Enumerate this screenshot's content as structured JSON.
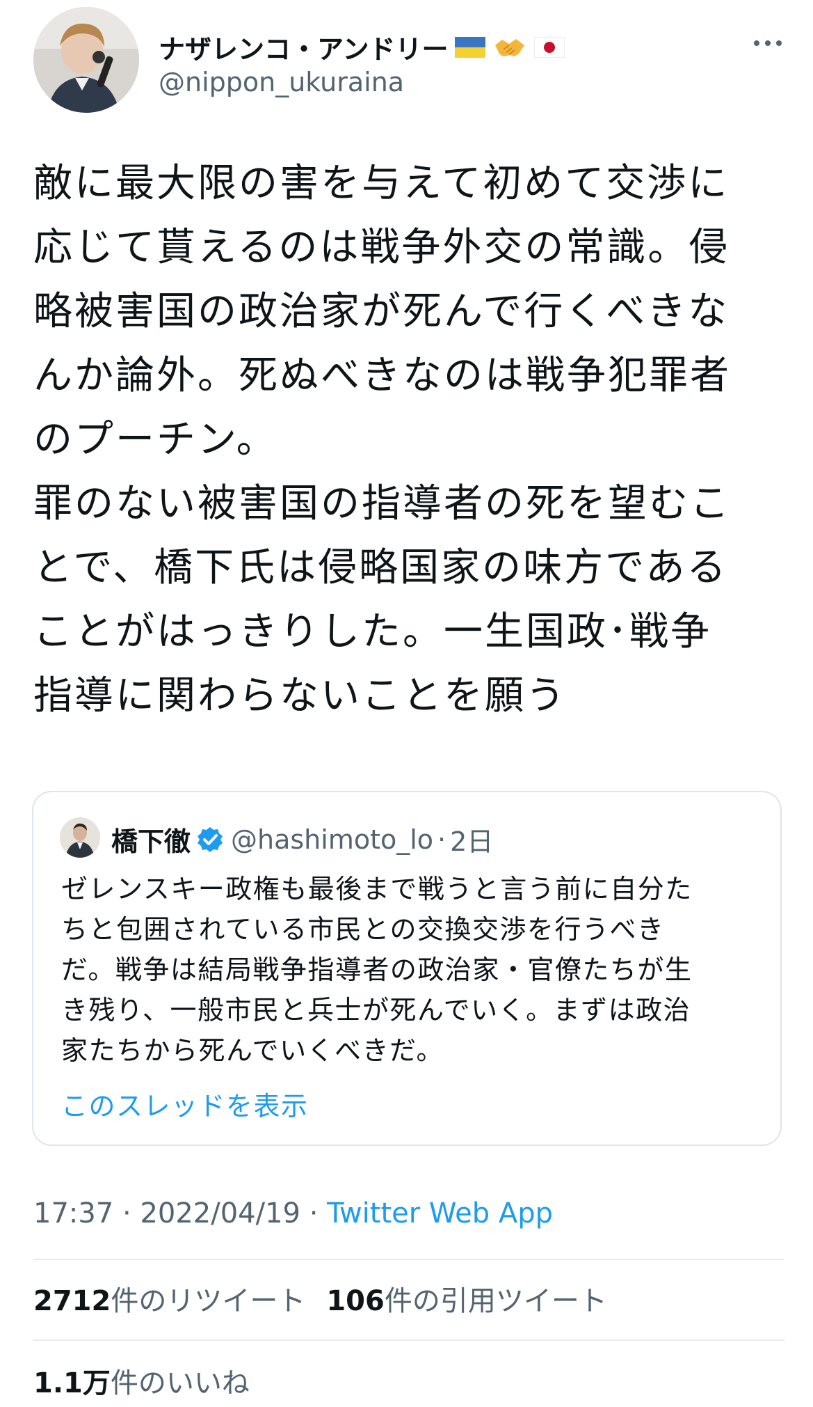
{
  "author": {
    "display_name": "ナザレンコ・アンドリー",
    "handle": "@nippon_ukuraina",
    "flags": [
      "ukraine-flag-icon",
      "handshake-icon",
      "japan-flag-icon"
    ]
  },
  "tweet": {
    "lines": [
      "敵に最大限の害を与えて初めて交渉に",
      "応じて貰えるのは戦争外交の常識。侵",
      "略被害国の政治家が死んで行くべきな",
      "んか論外。死ぬべきなのは戦争犯罪者",
      "のプーチン。",
      "罪のない被害国の指導者の死を望むこ",
      "とで、橋下氏は侵略国家の味方である",
      "ことがはっきりした。一生国政･戦争",
      "指導に関わらないことを願う"
    ]
  },
  "quoted": {
    "name": "橋下徹",
    "handle": "@hashimoto_lo",
    "separator": "·",
    "time": "2日",
    "lines": [
      "ゼレンスキー政権も最後まで戦うと言う前に自分た",
      "ちと包囲されている市民との交換交渉を行うべき",
      "だ。戦争は結局戦争指導者の政治家・官僚たちが生",
      "き残り、一般市民と兵士が死んでいく。まずは政治",
      "家たちから死んでいくべきだ。"
    ],
    "show_thread": "このスレッドを表示"
  },
  "meta": {
    "time": "17:37",
    "sep": " · ",
    "date": "2022/04/19",
    "app": "Twitter Web App"
  },
  "stats": {
    "retweets_count": "2712",
    "retweets_label": "件のリツイート",
    "quotes_count": "106",
    "quotes_label": "件の引用ツイート",
    "likes_count": "1.1万",
    "likes_label": "件のいいね"
  },
  "colors": {
    "link": "#1d9bf0",
    "secondary": "#536471",
    "verified": "#1d9bf0"
  }
}
